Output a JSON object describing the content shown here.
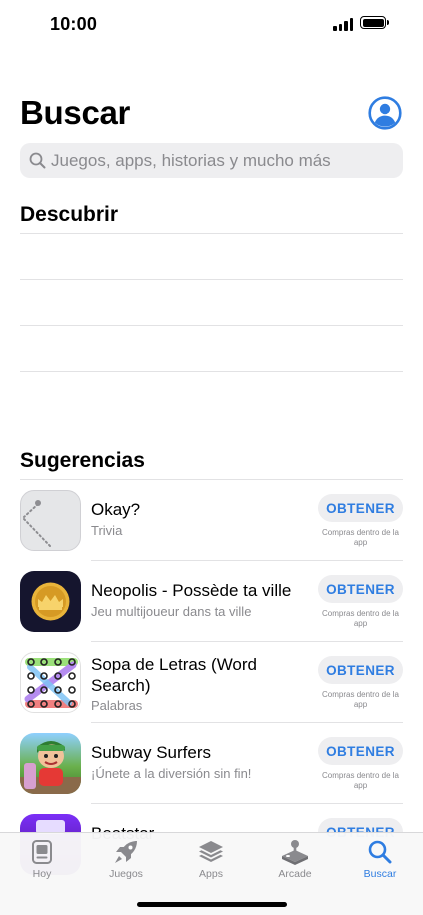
{
  "status_bar": {
    "time": "10:00"
  },
  "header": {
    "title": "Buscar"
  },
  "search": {
    "placeholder": "Juegos, apps, historias y mucho más"
  },
  "discover": {
    "title": "Descubrir"
  },
  "suggestions": {
    "title": "Sugerencias",
    "get_label": "OBTENER",
    "iap_label": "Compras dentro de la app",
    "apps": [
      {
        "name": "Okay?",
        "subtitle": "Trivia"
      },
      {
        "name": "Neopolis - Possède ta ville",
        "subtitle": "Jeu multijoueur dans ta ville"
      },
      {
        "name": "Sopa de Letras (Word Search)",
        "subtitle": "Palabras"
      },
      {
        "name": "Subway Surfers",
        "subtitle": "¡Únete a la diversión sin fin!"
      },
      {
        "name": "Beatstar"
      }
    ]
  },
  "tabs": [
    {
      "label": "Hoy",
      "icon": "today-icon"
    },
    {
      "label": "Juegos",
      "icon": "rocket-icon"
    },
    {
      "label": "Apps",
      "icon": "apps-stack-icon"
    },
    {
      "label": "Arcade",
      "icon": "arcade-joystick-icon"
    },
    {
      "label": "Buscar",
      "icon": "search-icon",
      "active": true
    }
  ],
  "colors": {
    "accent": "#2f7de1",
    "secondary_text": "#8a8a8e",
    "search_bg": "#eeeef0"
  }
}
